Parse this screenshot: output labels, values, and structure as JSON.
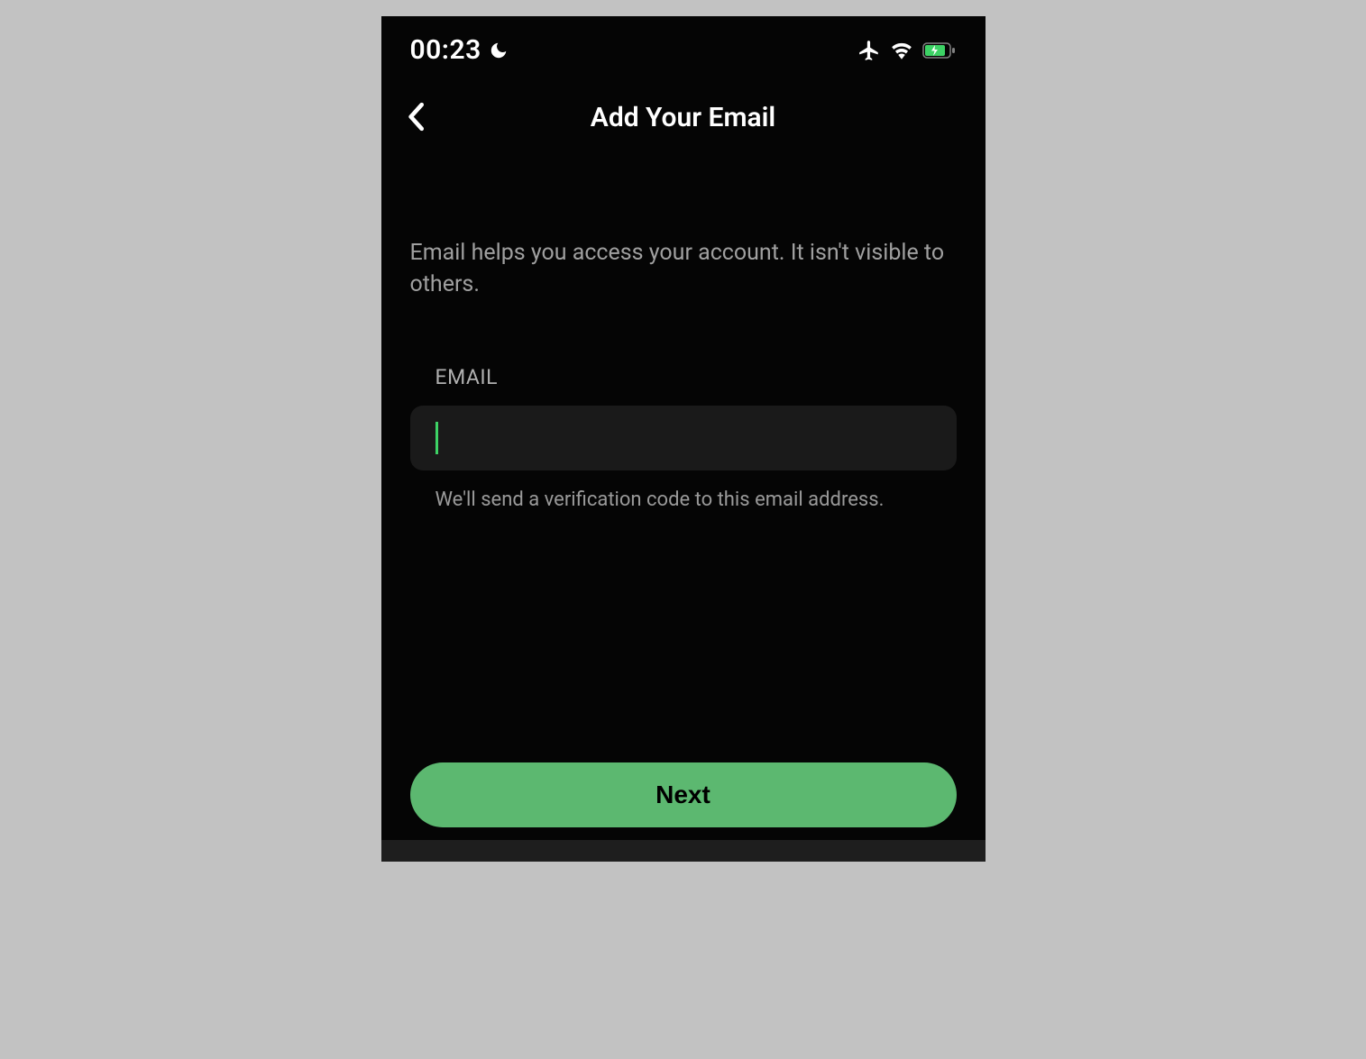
{
  "statusBar": {
    "time": "00:23"
  },
  "header": {
    "title": "Add Your Email"
  },
  "content": {
    "description": "Email helps you access your account. It isn't visible to others.",
    "emailLabel": "EMAIL",
    "emailValue": "",
    "helperText": "We'll send a verification code to this email address."
  },
  "actions": {
    "nextLabel": "Next"
  },
  "colors": {
    "accent": "#5cb870",
    "cursor": "#3dd265",
    "background": "#050505",
    "inputBackground": "#1a1a1a"
  }
}
